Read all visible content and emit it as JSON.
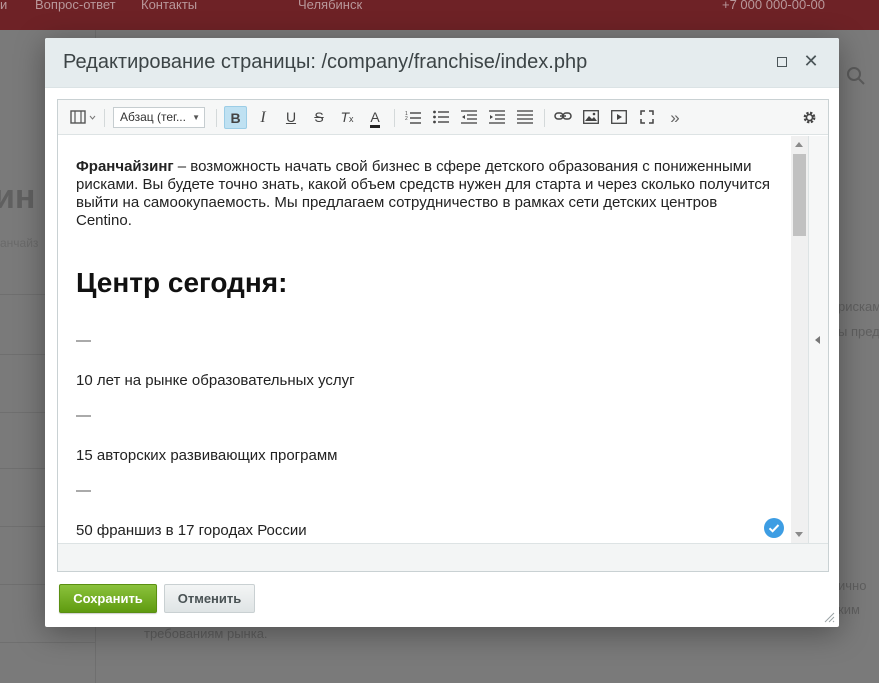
{
  "background": {
    "top_links": [
      "и",
      "Вопрос-ответ",
      "Контакты",
      "Челябинск",
      "+7 000 000-00-00"
    ],
    "heading_fragment": "ин",
    "subtext_fragment": "анчайз",
    "right_fragments": [
      "рискам",
      "ы пред",
      "ично",
      "ким"
    ],
    "bottom_fragment": "требованиям рынка."
  },
  "dialog": {
    "title": "Редактирование страницы: /company/franchise/index.php",
    "toolbar": {
      "format_select": "Абзац (тег...",
      "more_label": "»"
    },
    "content": {
      "intro_bold": "Франчайзинг",
      "intro_rest": " – возможность начать свой бизнес в сфере детского образования с пониженными рисками. Вы будете точно знать, какой объем средств нужен для старта и через сколько получится выйти на самоокупаемость. Мы предлагаем сотрудничество в рамках сети детских центров Centino.",
      "heading": "Центр сегодня:",
      "dash": "—",
      "items": [
        "10 лет на рынке образовательных услуг",
        "15 авторских развивающих программ",
        "50 франшиз в 17 городах России"
      ]
    },
    "buttons": {
      "save": "Сохранить",
      "cancel": "Отменить"
    }
  },
  "colors": {
    "accent_green": "#6aab1b",
    "active_button": "#bfe1f2",
    "badge_blue": "#3d9de3"
  }
}
